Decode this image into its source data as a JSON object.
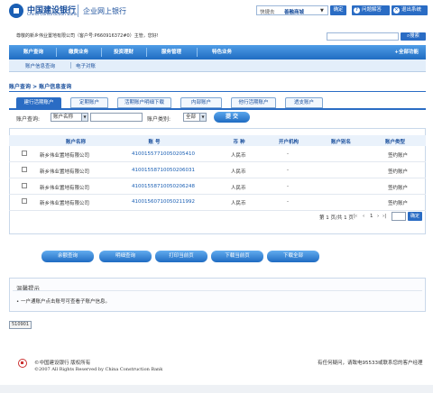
{
  "header": {
    "logo_cn": "中国建设银行",
    "logo_en": "China Construction Bank",
    "logo_sub": "企业网上银行",
    "shortcut_label": "快捷去",
    "shortcut_value": "善融商城",
    "ok_label": "确定",
    "faq_label": "问题解答",
    "faq_icon": "?",
    "logout_label": "退出系统",
    "logout_icon": "×"
  },
  "welcome": {
    "text": "尊敬的新乡伟业置地有限公司（客户号:P660916372#0）主管，您好!",
    "search_placeholder": "",
    "search_label": "搜索"
  },
  "mainnav": {
    "items": [
      "账户查询",
      "缴费业务",
      "投资理财",
      "服务管理",
      "特色业务"
    ],
    "all_functions": "全部功能"
  },
  "subnav": {
    "items": [
      "账户信息查询",
      "电子对账"
    ]
  },
  "breadcrumb": "账户查询 > 账户信息查询",
  "tabs": [
    "建行活期账户",
    "定期账户",
    "活期账户明细下载",
    "内部账户",
    "他行活期账户",
    "透支账户"
  ],
  "filter": {
    "query_label": "账户查询:",
    "query_select": "账户名称",
    "type_label": "账户类别:",
    "type_select": "全部",
    "submit_label": "提 交"
  },
  "table": {
    "columns": [
      "账户名称",
      "账   号",
      "币 种",
      "开户机构",
      "账户别名",
      "账户类型"
    ],
    "rows": [
      {
        "name": "新乡伟业置地有限公司",
        "account": "41001557710050205410",
        "currency": "人民币",
        "branch": "-",
        "alias": "",
        "type": "签约账户"
      },
      {
        "name": "新乡伟业置地有限公司",
        "account": "41001558710050206031",
        "currency": "人民币",
        "branch": "-",
        "alias": "",
        "type": "签约账户"
      },
      {
        "name": "新乡伟业置地有限公司",
        "account": "41001558710050206248",
        "currency": "人民币",
        "branch": "-",
        "alias": "",
        "type": "签约账户"
      },
      {
        "name": "新乡伟业置地有限公司",
        "account": "41001560710050211992",
        "currency": "人民币",
        "branch": "-",
        "alias": "",
        "type": "签约账户"
      }
    ]
  },
  "pager": {
    "text": "第 1 页/共 1 页",
    "prev": "|‹",
    "prev2": "‹",
    "current": "1",
    "next": "›",
    "last": "›|",
    "go_label": "确定"
  },
  "actions": [
    "余额查询",
    "明细查询",
    "打印当前页",
    "下载当前页",
    "下载全部"
  ],
  "tips": {
    "title": "温馨提示",
    "text": "• 一户通账户点击账号可查看子账户信息。"
  },
  "code_label": "510901",
  "footer": {
    "bank": "©中国建设银行  版权所有",
    "copy": "©2007 All Rights Reserved by China Construction Bank",
    "right": "有任何疑问，请致电95533或联系您的客户经理"
  },
  "colors": {
    "brand_blue": "#2a6cc4",
    "nav_blue": "#1f6cc2",
    "link_blue": "#1a5fb4"
  }
}
